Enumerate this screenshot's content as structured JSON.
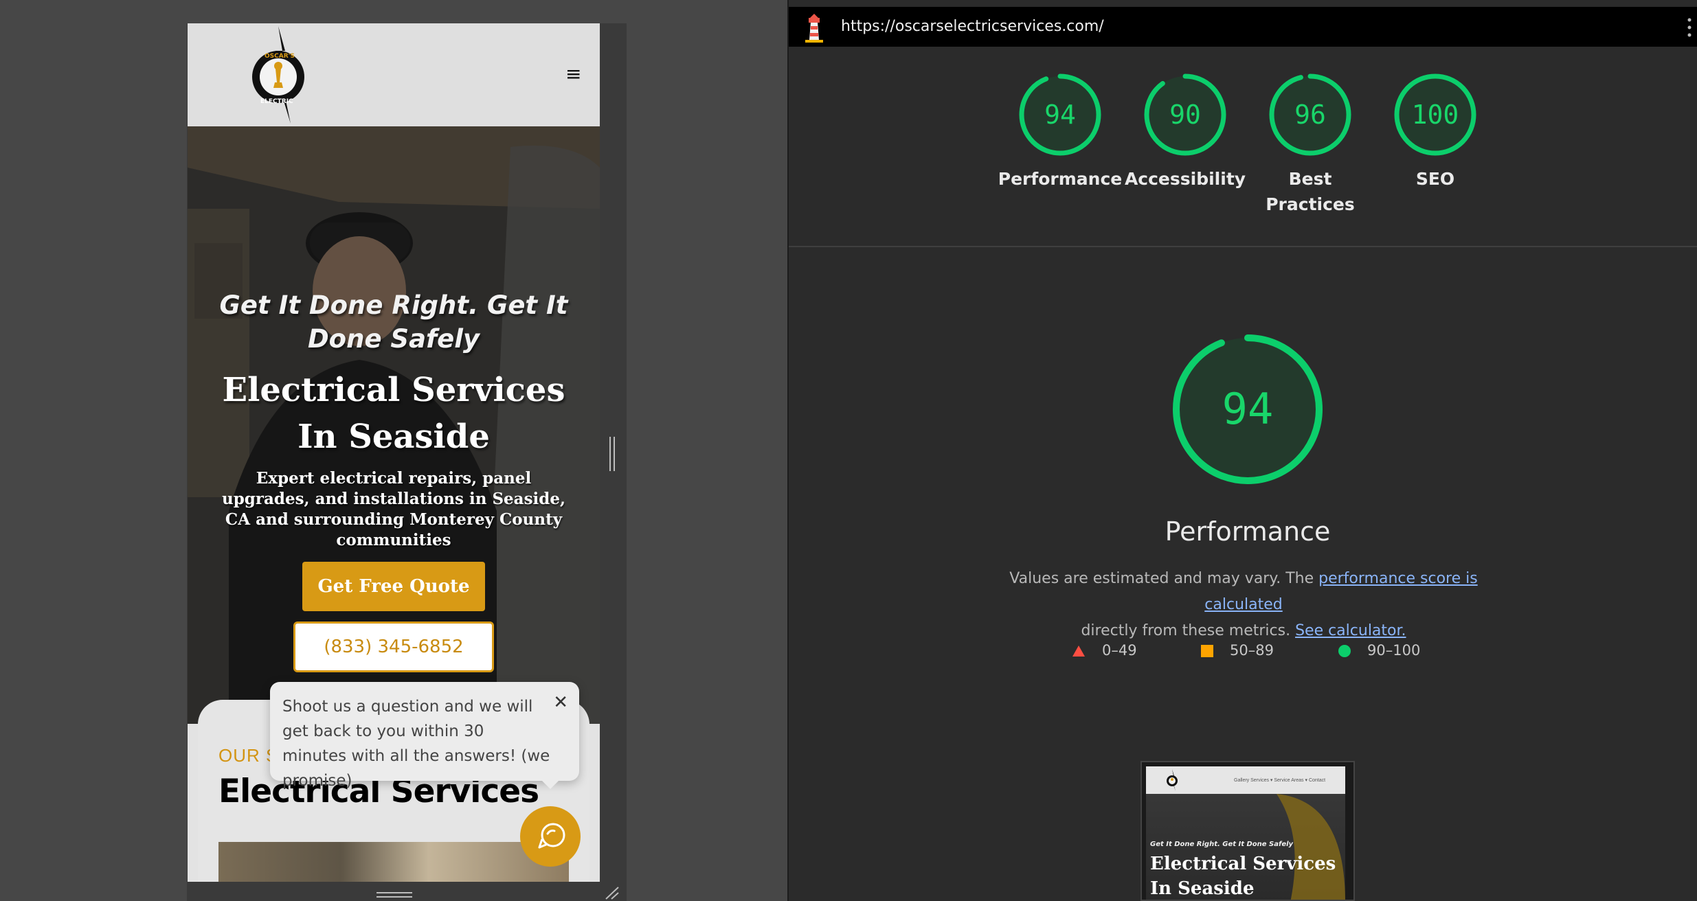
{
  "mobile_site": {
    "logo": {
      "text_top": "OSCAR'S",
      "text_bottom": "ELECTRIC"
    },
    "menu_icon": "hamburger-icon",
    "hero": {
      "tagline": "Get It Done Right. Get It Done Safely",
      "title": "Electrical Services In Seaside",
      "subtitle": "Expert electrical repairs, panel upgrades, and installations in Seaside, CA and surrounding Monterey County communities",
      "quote_button": "Get Free Quote",
      "phone_button": "(833) 345-6852"
    },
    "services": {
      "eyebrow": "OUR S",
      "title": "Electrical Services"
    },
    "chat": {
      "popup_text": "Shoot us a question and we will get back to you within 30 minutes with all the answers! (we promise)",
      "close_icon": "close-icon",
      "launcher_icon": "chat-bubble-icon"
    }
  },
  "lighthouse": {
    "url": "https://oscarselectricservices.com/",
    "gauges": [
      {
        "score": "94",
        "value": 94,
        "label": "Performance"
      },
      {
        "score": "90",
        "value": 90,
        "label": "Accessibility"
      },
      {
        "score": "96",
        "value": 96,
        "label": "Best Practices"
      },
      {
        "score": "100",
        "value": 100,
        "label": "SEO"
      }
    ],
    "main_gauge": {
      "score": "94",
      "value": 94,
      "label": "Performance"
    },
    "description_prefix": "Values are estimated and may vary. The ",
    "description_link": "performance score is calculated",
    "description_middle": " directly from these metrics. ",
    "calculator_link": "See calculator.",
    "legend": [
      {
        "range": "0–49",
        "shape": "triangle",
        "color": "#ff4e42"
      },
      {
        "range": "50–89",
        "shape": "square",
        "color": "#ffa400"
      },
      {
        "range": "90–100",
        "shape": "circle",
        "color": "#0cce6b"
      }
    ],
    "thumbnail": {
      "nav": "Gallery   Services ▾   Service Areas ▾   Contact",
      "tagline": "Get It Done Right. Get It Done Safely",
      "title": "Electrical Services In Seaside"
    }
  },
  "colors": {
    "accent": "#d89a15",
    "pass": "#0cce6b",
    "background": "#474747",
    "report_bg": "#2b2b2b"
  }
}
